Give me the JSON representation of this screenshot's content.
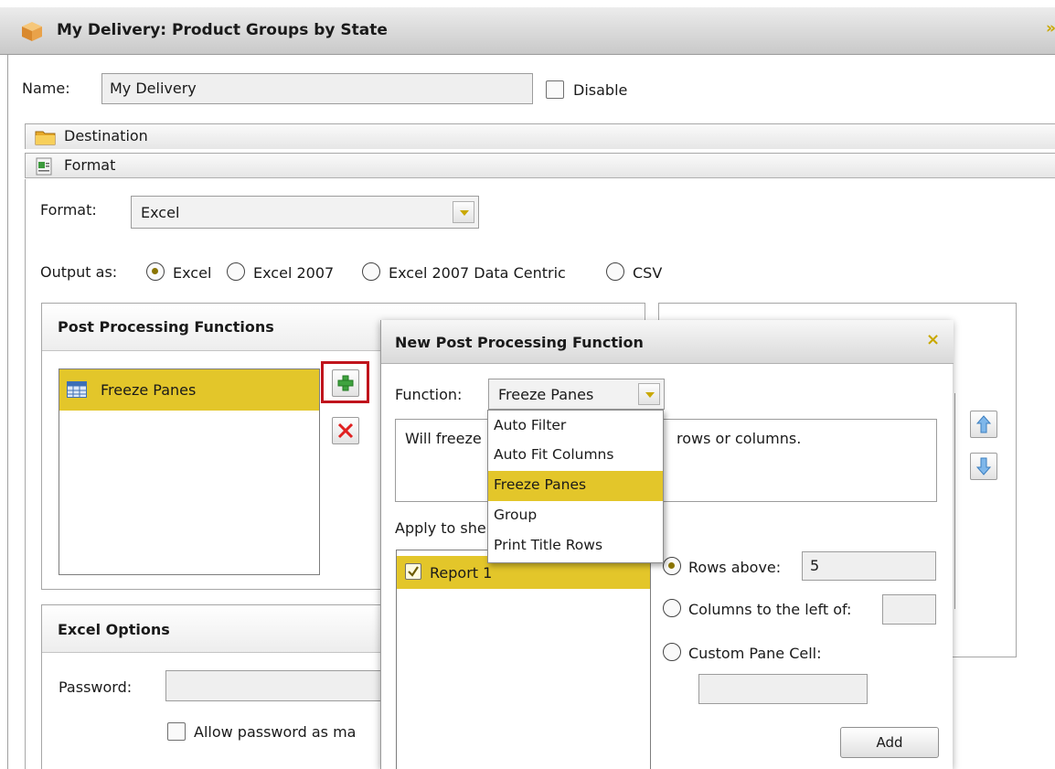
{
  "window": {
    "title": "My Delivery: Product Groups by State",
    "close_glyph": "»"
  },
  "form": {
    "name_label": "Name:",
    "name_value": "My Delivery",
    "disable_label": "Disable"
  },
  "sections": {
    "destination_label": "Destination",
    "format_label": "Format"
  },
  "format": {
    "format_label": "Format:",
    "format_value": "Excel",
    "output_label": "Output as:",
    "output_options": [
      "Excel",
      "Excel 2007",
      "Excel 2007 Data Centric",
      "CSV"
    ],
    "output_selected": "Excel"
  },
  "post_processing": {
    "title": "Post Processing Functions",
    "items": [
      "Freeze Panes"
    ]
  },
  "excel_options": {
    "title": "Excel Options",
    "password_label": "Password:",
    "allow_password_label": "Allow password as ma"
  },
  "dialog": {
    "title": "New Post Processing Function",
    "close_glyph": "×",
    "function_label": "Function:",
    "function_value": "Freeze Panes",
    "description_left": "Will freeze",
    "description_right": "rows or columns.",
    "apply_label": "Apply to she",
    "sheets": [
      {
        "label": "Report 1",
        "checked": true
      }
    ],
    "rows_above_label": "Rows above:",
    "rows_above_value": "5",
    "columns_left_label": "Columns to the left of:",
    "custom_pane_label": "Custom Pane Cell:",
    "add_button": "Add",
    "dropdown_options": [
      "Auto Filter",
      "Auto Fit Columns",
      "Freeze Panes",
      "Group",
      "Print Title Rows"
    ],
    "dropdown_selected": "Freeze Panes"
  },
  "colors": {
    "selection": "#e3c62a",
    "accent_gold": "#c9a800",
    "highlight_border": "#c0141c"
  }
}
